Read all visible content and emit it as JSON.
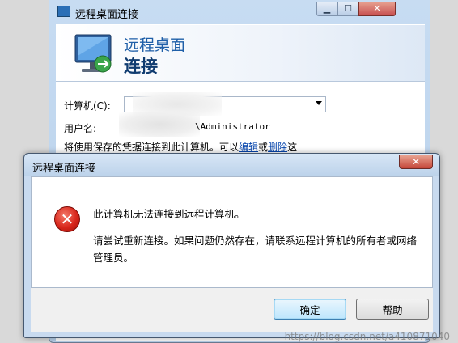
{
  "background_window": {
    "title": "远程桌面连接",
    "header_line1": "远程桌面",
    "header_line2": "连接",
    "computer_label": "计算机(C):",
    "computer_value": "",
    "username_label": "用户名:",
    "username_value": "\\Administrator",
    "saved_text": "将使用保存的凭据连接到此计算机。可以",
    "edit_link": "编辑",
    "or_text": "或",
    "delete_link": "删除",
    "saved_end": "这"
  },
  "error_dialog": {
    "title": "远程桌面连接",
    "close_glyph": "✕",
    "main_message": "此计算机无法连接到远程计算机。",
    "detail_message": "请尝试重新连接。如果问题仍然存在，请联系远程计算机的所有者或网络管理员。",
    "ok_label": "确定",
    "help_label": "帮助",
    "icon": "error-icon"
  },
  "window_controls": {
    "minimize": "▁",
    "maximize": "☐",
    "close": "✕"
  },
  "watermark": "https://blog.csdn.net/a410871040",
  "colors": {
    "title_blue": "#1f5fa8",
    "link_blue": "#0645ad",
    "error_red": "#d8261b"
  }
}
